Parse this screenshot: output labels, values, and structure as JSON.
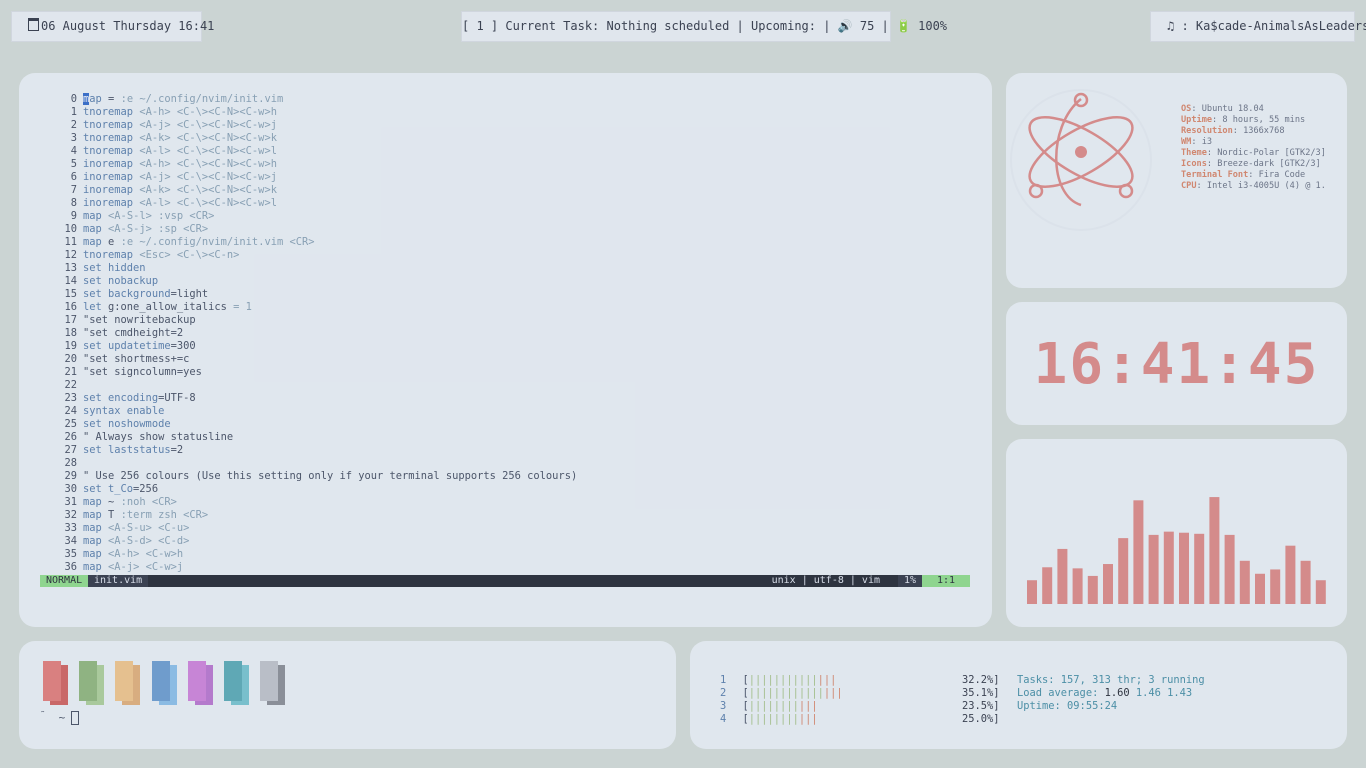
{
  "topbar": {
    "left": "06 August Thursday 16:41",
    "center": "[ 1 ] Current Task: Nothing scheduled | Upcoming: | 🔊 75 | 🔋 100%",
    "right": ": Ka$cade-AnimalsAsLeaders",
    "calendar_icon": "calendar-icon",
    "music_icon": "music-icon"
  },
  "editor": {
    "lines": [
      [
        [
          "cur",
          "m"
        ],
        [
          "k",
          "ap"
        ],
        [
          "t",
          " = "
        ],
        [
          "s",
          ":e ~/.config/nvim/init.vim"
        ]
      ],
      [
        [
          "k",
          "tnoremap"
        ],
        [
          "t",
          " "
        ],
        [
          "s",
          "<A-h>"
        ],
        [
          "t",
          " "
        ],
        [
          "s",
          "<C-\\><C-N><C-w>h"
        ]
      ],
      [
        [
          "k",
          "tnoremap"
        ],
        [
          "t",
          " "
        ],
        [
          "s",
          "<A-j>"
        ],
        [
          "t",
          " "
        ],
        [
          "s",
          "<C-\\><C-N><C-w>j"
        ]
      ],
      [
        [
          "k",
          "tnoremap"
        ],
        [
          "t",
          " "
        ],
        [
          "s",
          "<A-k>"
        ],
        [
          "t",
          " "
        ],
        [
          "s",
          "<C-\\><C-N><C-w>k"
        ]
      ],
      [
        [
          "k",
          "tnoremap"
        ],
        [
          "t",
          " "
        ],
        [
          "s",
          "<A-l>"
        ],
        [
          "t",
          " "
        ],
        [
          "s",
          "<C-\\><C-N><C-w>l"
        ]
      ],
      [
        [
          "k",
          "inoremap"
        ],
        [
          "t",
          " "
        ],
        [
          "s",
          "<A-h>"
        ],
        [
          "t",
          " "
        ],
        [
          "s",
          "<C-\\><C-N><C-w>h"
        ]
      ],
      [
        [
          "k",
          "inoremap"
        ],
        [
          "t",
          " "
        ],
        [
          "s",
          "<A-j>"
        ],
        [
          "t",
          " "
        ],
        [
          "s",
          "<C-\\><C-N><C-w>j"
        ]
      ],
      [
        [
          "k",
          "inoremap"
        ],
        [
          "t",
          " "
        ],
        [
          "s",
          "<A-k>"
        ],
        [
          "t",
          " "
        ],
        [
          "s",
          "<C-\\><C-N><C-w>k"
        ]
      ],
      [
        [
          "k",
          "inoremap"
        ],
        [
          "t",
          " "
        ],
        [
          "s",
          "<A-l>"
        ],
        [
          "t",
          " "
        ],
        [
          "s",
          "<C-\\><C-N><C-w>l"
        ]
      ],
      [
        [
          "k",
          "map"
        ],
        [
          "t",
          " "
        ],
        [
          "s",
          "<A-S-l>"
        ],
        [
          "t",
          " "
        ],
        [
          "s",
          ":vsp"
        ],
        [
          "t",
          " "
        ],
        [
          "s",
          "<CR>"
        ]
      ],
      [
        [
          "k",
          "map"
        ],
        [
          "t",
          " "
        ],
        [
          "s",
          "<A-S-j>"
        ],
        [
          "t",
          " "
        ],
        [
          "s",
          ":sp"
        ],
        [
          "t",
          " "
        ],
        [
          "s",
          "<CR>"
        ]
      ],
      [
        [
          "k",
          "map"
        ],
        [
          "t",
          " e "
        ],
        [
          "s",
          ":e ~/.config/nvim/init.vim"
        ],
        [
          "t",
          " "
        ],
        [
          "s",
          "<CR>"
        ]
      ],
      [
        [
          "k",
          "tnoremap"
        ],
        [
          "t",
          " "
        ],
        [
          "s",
          "<Esc>"
        ],
        [
          "t",
          " "
        ],
        [
          "s",
          "<C-\\><C-n>"
        ]
      ],
      [
        [
          "k",
          "set hidden"
        ]
      ],
      [
        [
          "k",
          "set nobackup"
        ]
      ],
      [
        [
          "k",
          "set background"
        ],
        [
          "t",
          "=light"
        ]
      ],
      [
        [
          "k",
          "let"
        ],
        [
          "t",
          " g:one_allow_italics "
        ],
        [
          "s",
          "= 1"
        ]
      ],
      [
        [
          "t",
          "\"set nowritebackup"
        ]
      ],
      [
        [
          "t",
          "\"set cmdheight=2"
        ]
      ],
      [
        [
          "k",
          "set updatetime"
        ],
        [
          "t",
          "=300"
        ]
      ],
      [
        [
          "t",
          "\"set shortmess+=c"
        ]
      ],
      [
        [
          "t",
          "\"set signcolumn=yes"
        ]
      ],
      [
        [
          "t",
          ""
        ]
      ],
      [
        [
          "k",
          "set encoding"
        ],
        [
          "t",
          "=UTF-8"
        ]
      ],
      [
        [
          "k",
          "syntax enable"
        ]
      ],
      [
        [
          "k",
          "set noshowmode"
        ]
      ],
      [
        [
          "t",
          "\" Always show statusline"
        ]
      ],
      [
        [
          "k",
          "set laststatus"
        ],
        [
          "t",
          "=2"
        ]
      ],
      [
        [
          "t",
          ""
        ]
      ],
      [
        [
          "t",
          "\" Use 256 colours (Use this setting only if your terminal supports 256 colours)"
        ]
      ],
      [
        [
          "k",
          "set t_Co"
        ],
        [
          "t",
          "=256"
        ]
      ],
      [
        [
          "k",
          "map"
        ],
        [
          "t",
          " ~ "
        ],
        [
          "s",
          ":noh"
        ],
        [
          "t",
          " "
        ],
        [
          "s",
          "<CR>"
        ]
      ],
      [
        [
          "k",
          "map"
        ],
        [
          "t",
          " T "
        ],
        [
          "s",
          ":term zsh"
        ],
        [
          "t",
          " "
        ],
        [
          "s",
          "<CR>"
        ]
      ],
      [
        [
          "k",
          "map"
        ],
        [
          "t",
          " "
        ],
        [
          "s",
          "<A-S-u>"
        ],
        [
          "t",
          " "
        ],
        [
          "s",
          "<C-u>"
        ]
      ],
      [
        [
          "k",
          "map"
        ],
        [
          "t",
          " "
        ],
        [
          "s",
          "<A-S-d>"
        ],
        [
          "t",
          " "
        ],
        [
          "s",
          "<C-d>"
        ]
      ],
      [
        [
          "k",
          "map"
        ],
        [
          "t",
          " "
        ],
        [
          "s",
          "<A-h>"
        ],
        [
          "t",
          " "
        ],
        [
          "s",
          "<C-w>h"
        ]
      ],
      [
        [
          "k",
          "map"
        ],
        [
          "t",
          " "
        ],
        [
          "s",
          "<A-j>"
        ],
        [
          "t",
          " "
        ],
        [
          "s",
          "<C-w>j"
        ]
      ]
    ],
    "statusline": {
      "mode": "NORMAL",
      "file": "init.vim",
      "info": "unix | utf-8 | vim",
      "percent": "1%",
      "position": "1:1"
    }
  },
  "sysinfo": {
    "logo_icon": "electron-atom-icon",
    "rows": [
      {
        "label": "OS",
        "value": "Ubuntu 18.04"
      },
      {
        "label": "Uptime",
        "value": "8 hours, 55 mins"
      },
      {
        "label": "Resolution",
        "value": "1366x768"
      },
      {
        "label": "WM",
        "value": "i3"
      },
      {
        "label": "Theme",
        "value": "Nordic-Polar [GTK2/3]"
      },
      {
        "label": "Icons",
        "value": "Breeze-dark [GTK2/3]"
      },
      {
        "label": "Terminal Font",
        "value": "Fira Code"
      },
      {
        "label": "CPU",
        "value": "Intel i3-4005U (4) @ 1."
      }
    ]
  },
  "clock": {
    "time": "16:41:45"
  },
  "visualizer": {
    "color": "#d48b8b",
    "levels": [
      0.22,
      0.34,
      0.51,
      0.33,
      0.26,
      0.37,
      0.61,
      0.96,
      0.64,
      0.67,
      0.66,
      0.65,
      0.99,
      0.64,
      0.4,
      0.28,
      0.32,
      0.54,
      0.4,
      0.22
    ]
  },
  "terminal": {
    "prompt": "~",
    "palette": [
      [
        "#d98080",
        "#c96868"
      ],
      [
        "#8fb382",
        "#a9c99c"
      ],
      [
        "#e5c08f",
        "#d8ad80"
      ],
      [
        "#6f9ccc",
        "#8bbbe3"
      ],
      [
        "#c785d6",
        "#b47acc"
      ],
      [
        "#5fa8b5",
        "#79bfcc"
      ],
      [
        "#b9bec7",
        "#8a8f98"
      ]
    ]
  },
  "htop": {
    "cpus": [
      {
        "num": "1",
        "green": "|||||||||||",
        "red": "|||",
        "percent": "32.2%]"
      },
      {
        "num": "2",
        "green": "||||||||||||",
        "red": "|||",
        "percent": "35.1%]"
      },
      {
        "num": "3",
        "green": "||||||||",
        "red": "|||",
        "percent": "23.5%]"
      },
      {
        "num": "4",
        "green": "||||||||",
        "red": "|||",
        "percent": "25.0%]"
      }
    ],
    "tasks_label": "Tasks: ",
    "tasks_value": "157, 313 thr; 3 running",
    "load_label": "Load average: ",
    "load_1": "1.60",
    "load_rest": " 1.46 1.43",
    "uptime_label": "Uptime: ",
    "uptime_value": "09:55:24"
  }
}
